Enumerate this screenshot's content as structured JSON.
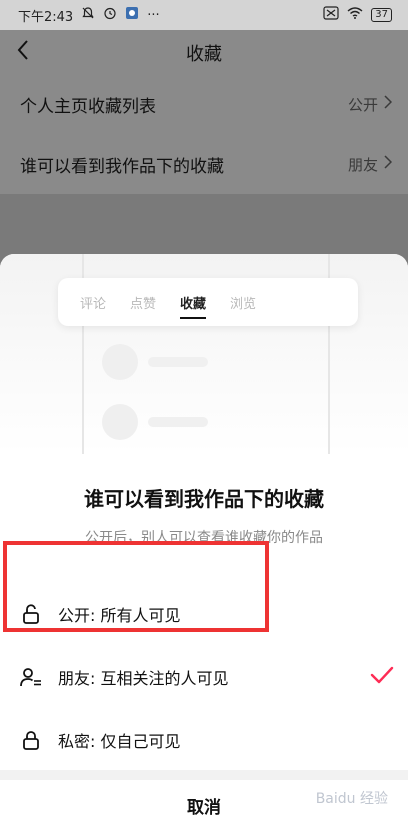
{
  "status_bar": {
    "time": "下午2:43",
    "battery": "37"
  },
  "header": {
    "title": "收藏"
  },
  "settings": [
    {
      "label": "个人主页收藏列表",
      "value": "公开"
    },
    {
      "label": "谁可以看到我作品下的收藏",
      "value": "朋友"
    }
  ],
  "sheet": {
    "preview_tabs": [
      "评论",
      "点赞",
      "收藏",
      "浏览"
    ],
    "active_tab": "收藏",
    "title": "谁可以看到我作品下的收藏",
    "subtitle": "公开后，别人可以查看谁收藏你的作品",
    "options": [
      {
        "label": "公开: 所有人可见",
        "icon": "unlock-icon",
        "selected": false
      },
      {
        "label": "朋友: 互相关注的人可见",
        "icon": "friends-icon",
        "selected": true
      },
      {
        "label": "私密: 仅自己可见",
        "icon": "lock-icon",
        "selected": false
      }
    ],
    "cancel_label": "取消"
  },
  "accent_color": "#fe2c55",
  "highlight_color": "#ee3333",
  "watermark": "Baidu 经验"
}
